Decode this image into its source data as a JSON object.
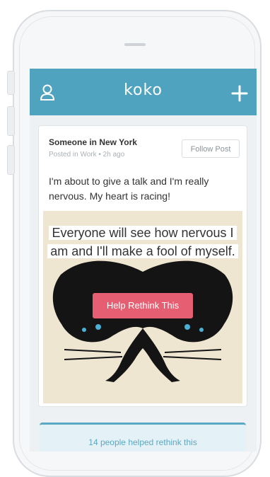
{
  "header": {
    "logo_text": "koko",
    "user_icon": "user-icon",
    "add_icon": "plus-icon"
  },
  "post": {
    "author": "Someone in New York",
    "meta": "Posted in Work • 2h ago",
    "follow_label": "Follow Post",
    "body": "I'm about to give a talk and I'm really nervous. My heart is racing!",
    "thought": "Everyone will see how nervous I am and I'll make a fool of myself.",
    "rethink_label": "Help Rethink This"
  },
  "footer": {
    "helped_text": "14 people helped rethink this"
  },
  "colors": {
    "accent": "#4fa3be",
    "button": "#e55e72",
    "art_background": "#efe6d1"
  }
}
